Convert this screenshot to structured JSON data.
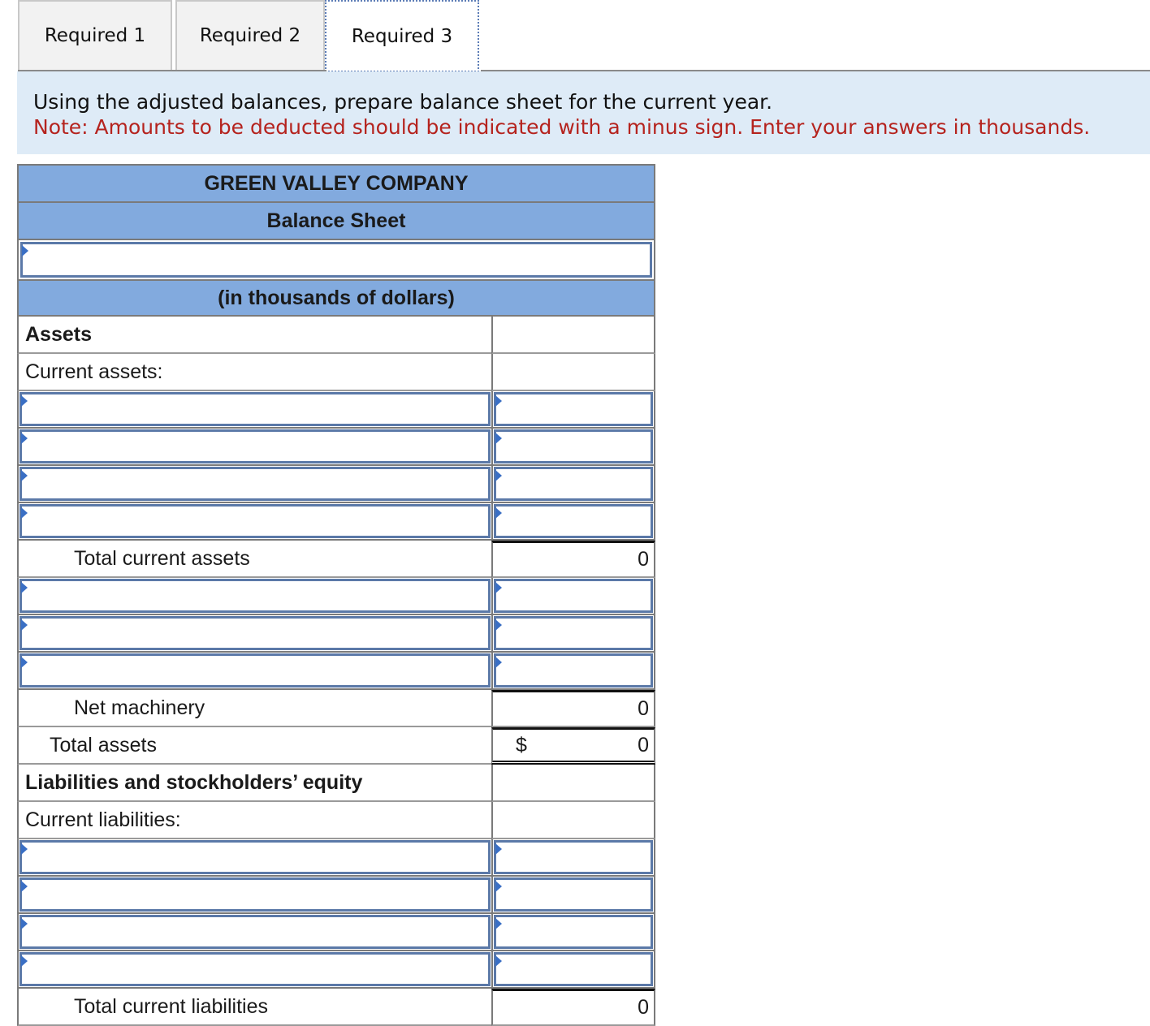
{
  "tabs": [
    {
      "label": "Required 1",
      "active": false
    },
    {
      "label": "Required 2",
      "active": false
    },
    {
      "label": "Required 3",
      "active": true
    }
  ],
  "instructions": {
    "main": "Using the adjusted balances, prepare balance sheet for the current year.",
    "note": "Note: Amounts to be deducted should be indicated with a minus sign. Enter your answers in thousands."
  },
  "sheet": {
    "company": "GREEN VALLEY COMPANY",
    "title": "Balance Sheet",
    "date_value": "",
    "units": "(in thousands of dollars)",
    "assets_label": "Assets",
    "current_assets_label": "Current assets:",
    "current_asset_inputs": [
      {
        "label": "",
        "amount": ""
      },
      {
        "label": "",
        "amount": ""
      },
      {
        "label": "",
        "amount": ""
      },
      {
        "label": "",
        "amount": ""
      }
    ],
    "total_current_assets_label": "Total current assets",
    "total_current_assets_value": "0",
    "machinery_inputs": [
      {
        "label": "",
        "amount": ""
      },
      {
        "label": "",
        "amount": ""
      },
      {
        "label": "",
        "amount": ""
      }
    ],
    "net_machinery_label": "Net machinery",
    "net_machinery_value": "0",
    "total_assets_label": "Total assets",
    "total_assets_currency": "$",
    "total_assets_value": "0",
    "liab_equity_label": "Liabilities and stockholders’ equity",
    "current_liabilities_label": "Current liabilities:",
    "current_liability_inputs": [
      {
        "label": "",
        "amount": ""
      },
      {
        "label": "",
        "amount": ""
      },
      {
        "label": "",
        "amount": ""
      },
      {
        "label": "",
        "amount": ""
      }
    ],
    "total_current_liabilities_label": "Total current liabilities",
    "total_current_liabilities_value": "0"
  }
}
